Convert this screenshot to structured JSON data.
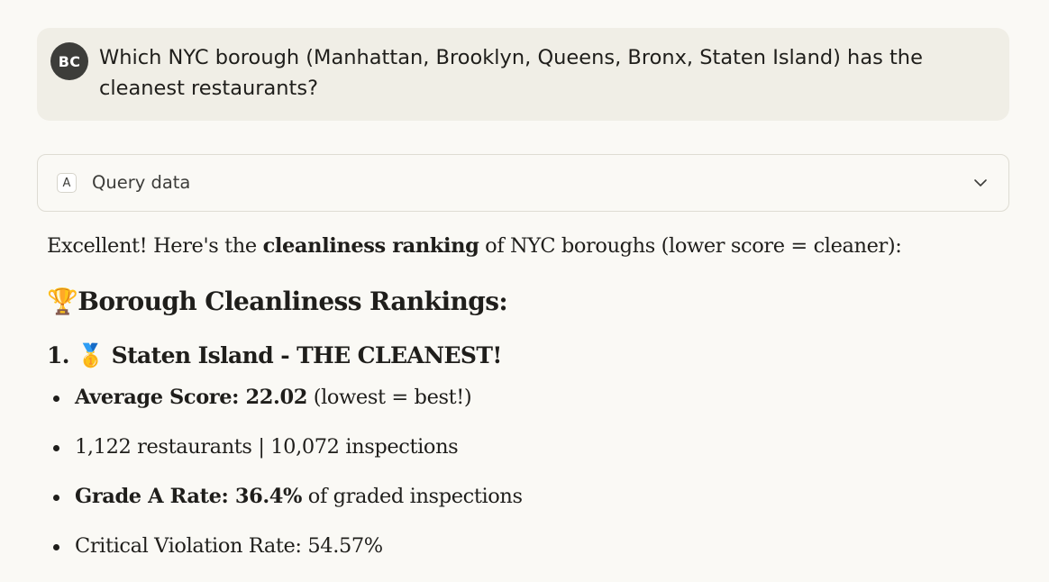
{
  "user_message": {
    "avatar_initials": "BC",
    "text": "Which NYC borough (Manhattan, Brooklyn, Queens, Bronx, Staten Island) has the cleanest restaurants?"
  },
  "tool_call": {
    "badge_letter": "A",
    "label": "Query data",
    "expand_icon": "chevron-down-icon"
  },
  "response": {
    "intro_prefix": "Excellent! Here's the ",
    "intro_bold": "cleanliness ranking",
    "intro_suffix": " of NYC boroughs (lower score = cleaner):",
    "heading_emoji": "🏆",
    "heading_text": "Borough Cleanliness Rankings:",
    "rank_number": "1.",
    "rank_emoji": "🥇",
    "rank_title": "Staten Island - THE CLEANEST!",
    "bullets": [
      {
        "bold": "Average Score: 22.02",
        "text": " (lowest = best!)"
      },
      {
        "bold": "",
        "text": "1,122 restaurants | 10,072 inspections"
      },
      {
        "bold": "Grade A Rate: 36.4%",
        "text": " of graded inspections"
      },
      {
        "bold": "",
        "text": "Critical Violation Rate: 54.57%"
      }
    ]
  },
  "colors": {
    "page_background": "#faf9f5",
    "user_bubble": "#f0eee6",
    "avatar_background": "#3d3d3a",
    "text": "#1f1e1b"
  }
}
